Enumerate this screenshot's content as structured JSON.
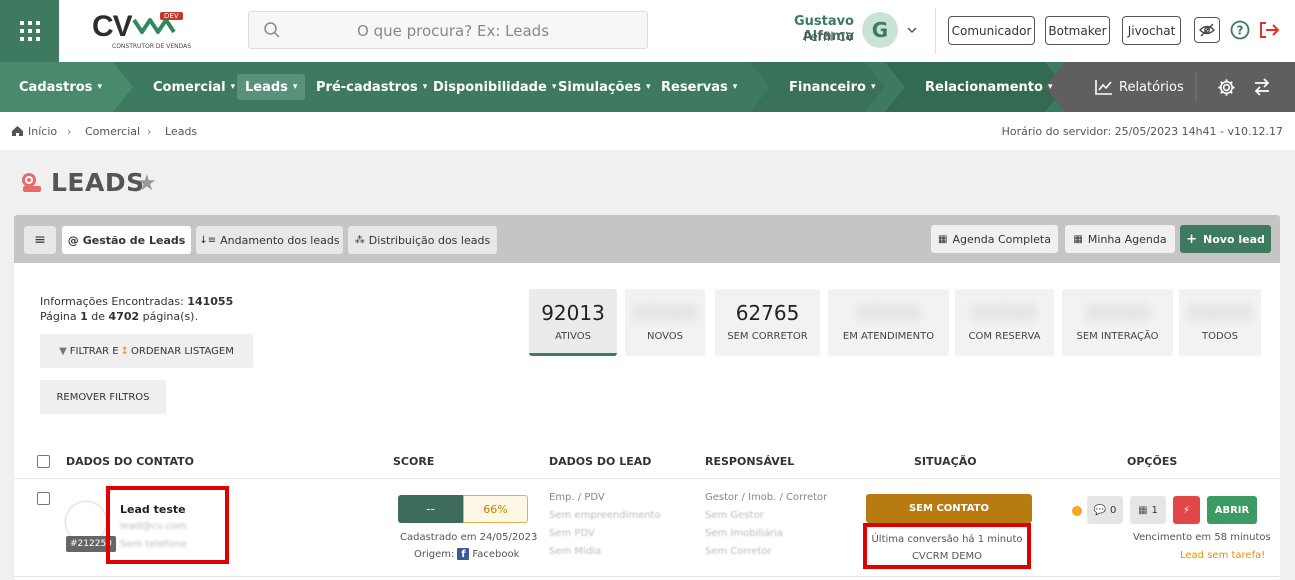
{
  "header": {
    "logo_text": "CV",
    "logo_dev": "DEV",
    "logo_sub": "CONSTRUTOR DE VENDAS",
    "search_placeholder": "O que procura? Ex: Leads",
    "user_name": "Gustavo Alfama",
    "user_profile": "Perfil CV",
    "avatar_initial": "G",
    "buttons": [
      "Comunicador",
      "Botmaker",
      "Jivochat"
    ]
  },
  "nav": {
    "items": [
      "Cadastros",
      "Comercial",
      "Leads",
      "Pré-cadastros",
      "Disponibilidade",
      "Simulações",
      "Reservas",
      "Financeiro",
      "Relacionamento",
      "Relatórios"
    ],
    "active": "Leads",
    "colors": {
      "primary": "#3d7a5f",
      "dark": "#2f6a50",
      "gray": "#5f5f5f"
    }
  },
  "breadcrumb": [
    "Início",
    "Comercial",
    "Leads"
  ],
  "server_time": "Horário do servidor: 25/05/2023 14h41 - v10.12.17",
  "page_title": "LEADS",
  "tabs": [
    "Gestão de Leads",
    "Andamento dos leads",
    "Distribuição dos leads"
  ],
  "tab_active": "Gestão de Leads",
  "actions": [
    "Agenda Completa",
    "Minha Agenda",
    "Novo lead"
  ],
  "info": {
    "found_label": "Informações Encontradas:",
    "found_count": "141055",
    "page_prefix": "Página",
    "page_current": "1",
    "page_of": "de",
    "page_total": "4702",
    "page_suffix": "página(s).",
    "filter_btn": "FILTRAR E",
    "filter_btn2": "ORDENAR LISTAGEM",
    "remove_btn": "REMOVER FILTROS"
  },
  "stats": [
    {
      "value": "92013",
      "label": "ATIVOS",
      "active": true
    },
    {
      "value": "00000",
      "label": "NOVOS",
      "blurred": true
    },
    {
      "value": "62765",
      "label": "SEM CORRETOR"
    },
    {
      "value": "00000",
      "label": "EM ATENDIMENTO",
      "blurred": true
    },
    {
      "value": "00000",
      "label": "COM RESERVA",
      "blurred": true
    },
    {
      "value": "00000",
      "label": "SEM INTERAÇÃO",
      "blurred": true
    },
    {
      "value": "00000",
      "label": "TODOS",
      "blurred": true
    }
  ],
  "table": {
    "headers": [
      "DADOS DO CONTATO",
      "SCORE",
      "DADOS DO LEAD",
      "RESPONSÁVEL",
      "SITUAÇÃO",
      "OPÇÕES"
    ],
    "row": {
      "id": "#212250",
      "name": "Lead teste",
      "email": "lead@cv.com",
      "phone": "Sem telefone",
      "score_left": "--",
      "score_right": "66%",
      "created": "Cadastrado em 24/05/2023",
      "origin_label": "Origem:",
      "origin": "Facebook",
      "lead_header": "Emp. / PDV",
      "lead_lines": [
        "Sem empreendimento",
        "Sem PDV",
        "Sem Mídia"
      ],
      "resp_header": "Gestor / Imob. / Corretor",
      "resp_lines": [
        "Sem Gestor",
        "Sem Imobiliária",
        "Sem Corretor"
      ],
      "situation": "SEM CONTATO",
      "last_conversion": "Última conversão há 1 minuto",
      "conversion_source": "CVCRM DEMO",
      "comments": "0",
      "tasks": "1",
      "open_btn": "ABRIR",
      "expire": "Vencimento em 58 minutos",
      "no_task": "Lead sem tarefa!"
    }
  }
}
